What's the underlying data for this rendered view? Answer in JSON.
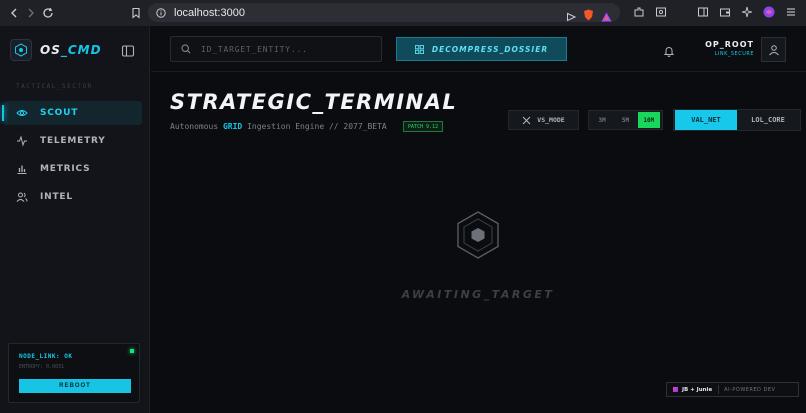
{
  "browser": {
    "url": "localhost:3000"
  },
  "sidebar": {
    "logo_prefix": "OS",
    "logo_suffix": "CMD",
    "section_label": "TACTICAL_SECTOR",
    "items": [
      {
        "label": "SCOUT",
        "icon": "eye-icon",
        "active": true
      },
      {
        "label": "TELEMETRY",
        "icon": "activity-icon",
        "active": false
      },
      {
        "label": "METRICS",
        "icon": "bar-chart-icon",
        "active": false
      },
      {
        "label": "INTEL",
        "icon": "users-icon",
        "active": false
      }
    ],
    "node": {
      "title": "NODE_LINK: OK",
      "entropy": "ENTROPY: 0.0031",
      "reboot_label": "REBOOT"
    }
  },
  "header": {
    "search_placeholder": "ID_TARGET_ENTITY...",
    "decompress_label": "DECOMPRESS_DOSSIER",
    "user_name": "OP_ROOT",
    "user_status": "LINK_SECURE"
  },
  "hero": {
    "title": "STRATEGIC_TERMINAL",
    "subtitle_pre": "Autonomous ",
    "subtitle_hl": "GRID",
    "subtitle_post": " Ingestion Engine // 2077_BETA",
    "patch": "PATCH 9.12",
    "vs_mode": "VS_MODE",
    "time_options": [
      "3M",
      "5M",
      "10M"
    ],
    "time_active": "10M",
    "region_options": [
      "VAL_NET",
      "LOL_CORE"
    ],
    "region_active": "VAL_NET"
  },
  "empty_state": {
    "label": "AWAITING_TARGET"
  },
  "footer_badge": {
    "brand": "JB + Junie",
    "tag": "AI-POWERED DEV"
  },
  "colors": {
    "accent": "#16c5e6",
    "success": "#19d65c",
    "background": "#0b0c0f"
  }
}
